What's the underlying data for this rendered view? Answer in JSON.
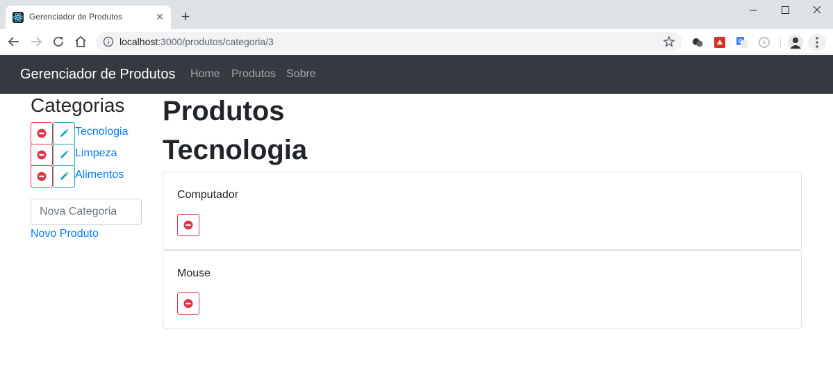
{
  "browser": {
    "tab_title": "Gerenciador de Produtos",
    "tab_close": "✕",
    "new_tab": "+",
    "url_host": "localhost",
    "url_rest": ":3000/produtos/categoria/3"
  },
  "navbar": {
    "brand": "Gerenciador de Produtos",
    "links": [
      "Home",
      "Produtos",
      "Sobre"
    ]
  },
  "sidebar": {
    "title": "Categorias",
    "categories": [
      {
        "label": "Tecnologia"
      },
      {
        "label": "Limpeza"
      },
      {
        "label": "Alimentos"
      }
    ],
    "new_category_placeholder": "Nova Categoria",
    "new_product_link": "Novo Produto"
  },
  "main": {
    "heading": "Produtos",
    "category_heading": "Tecnologia",
    "products": [
      {
        "name": "Computador"
      },
      {
        "name": "Mouse"
      }
    ]
  },
  "colors": {
    "navbar_bg": "#343a40",
    "danger": "#dc3545",
    "info": "#17a2b8",
    "link": "#007bff"
  },
  "icons": {
    "delete": "minus-circle-icon",
    "edit": "pencil-icon"
  }
}
